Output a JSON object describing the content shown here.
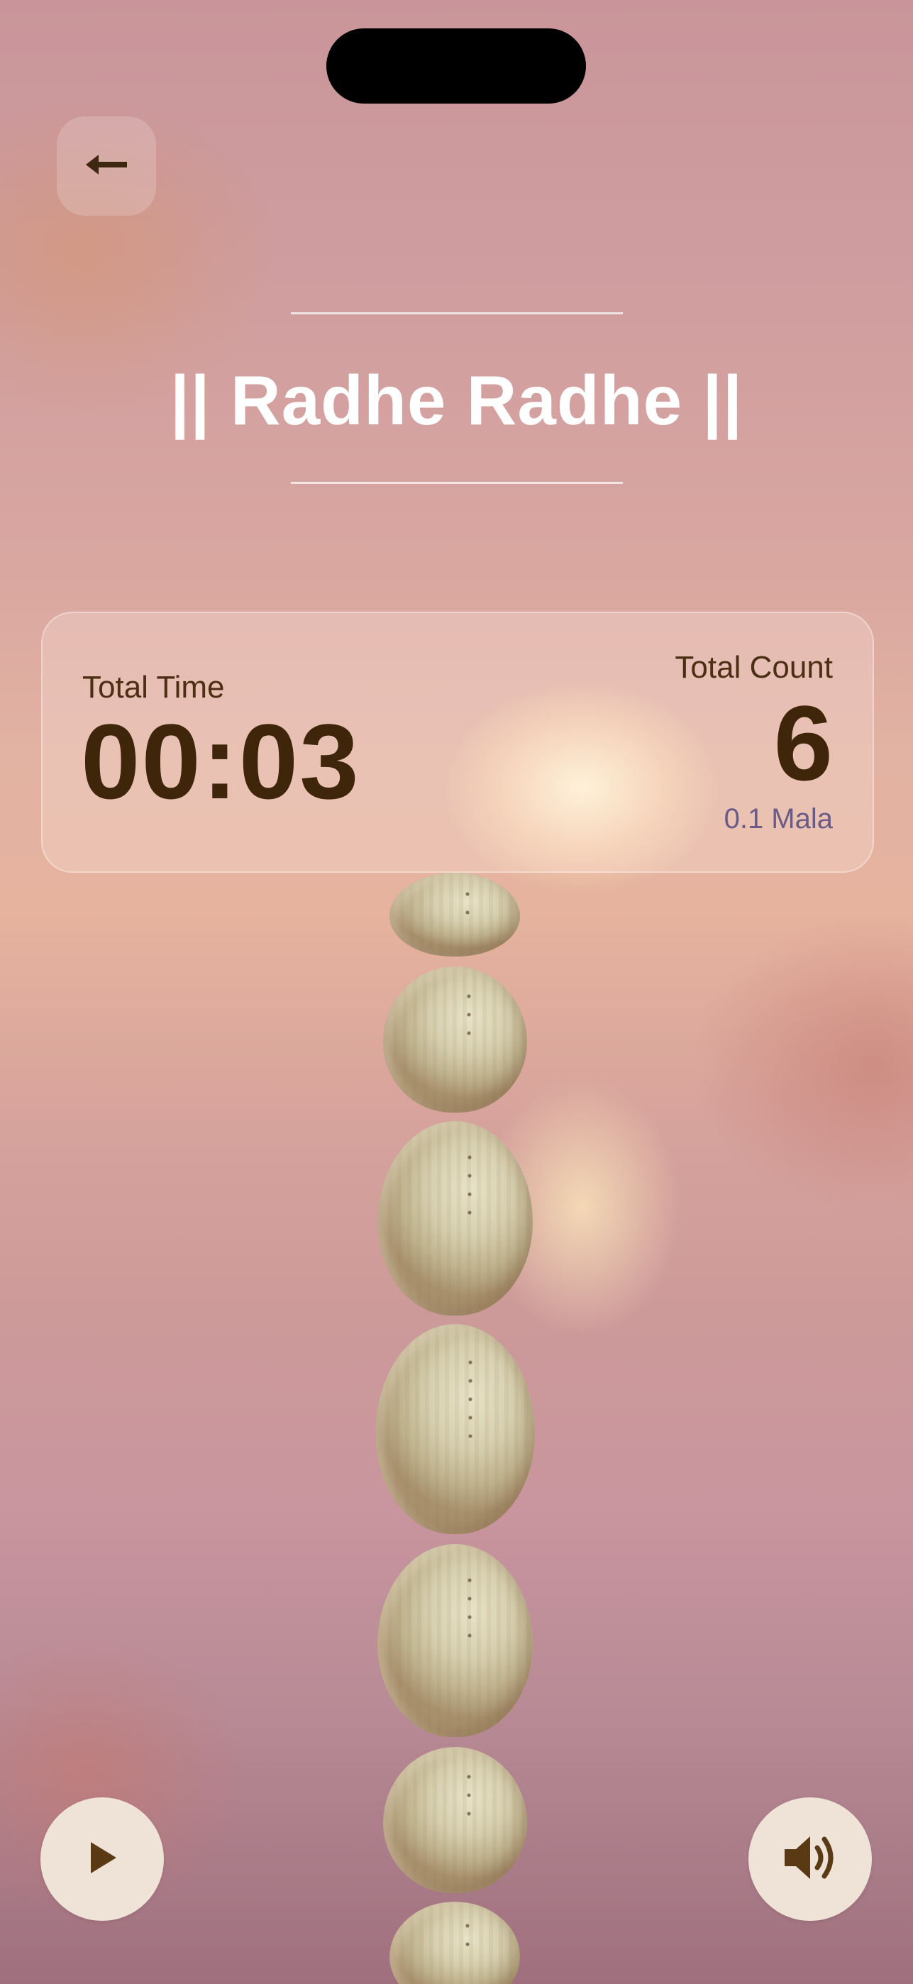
{
  "header": {
    "title": "|| Radhe Radhe ||"
  },
  "stats": {
    "time_label": "Total Time",
    "time_value": "00:03",
    "count_label": "Total Count",
    "count_value": "6",
    "mala_value": "0.1 Mala"
  },
  "icons": {
    "back": "arrow-left-icon",
    "play": "play-icon",
    "sound": "speaker-icon"
  },
  "colors": {
    "accent_dark": "#3f260b",
    "mala_text": "#6a5a86",
    "button_bg": "#efe3d8"
  }
}
